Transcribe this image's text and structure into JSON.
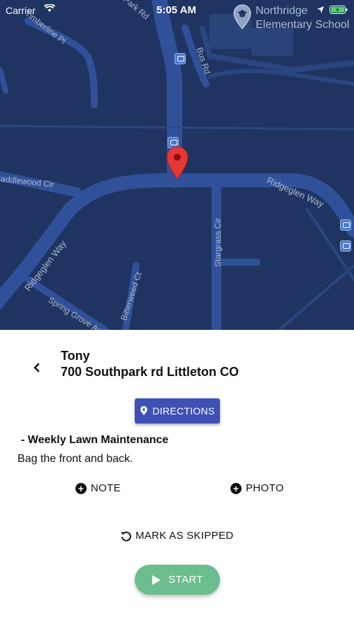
{
  "status_bar": {
    "carrier": "Carrier",
    "time": "5:05 AM"
  },
  "map": {
    "poi_label_line1": "Northridge",
    "poi_label_line2": "Elementary School",
    "streets": {
      "park_rd": "Park Rd",
      "timberline_pl": "Timberline Pl",
      "bus_rd": "Bus Rd",
      "saddlewood_cir": "Saddlewood Cir",
      "ridgeglen_way_east": "Ridgeglen Way",
      "ridgeglen_way_west": "Ridgeglen Way",
      "stargrass_cir": "Stargrass Cir",
      "bitterweed_ct": "Bitterweed Ct",
      "spring_grove": "Spring Grove Ave"
    },
    "colors": {
      "background": "#1f3461",
      "road": "#30519a",
      "marker": "#e53935"
    }
  },
  "job": {
    "client_name": "Tony",
    "address": "700 Southpark rd Littleton CO",
    "service_title": "- Weekly Lawn Maintenance",
    "service_description": "Bag the front and back."
  },
  "actions": {
    "directions_label": "DIRECTIONS",
    "note_label": "NOTE",
    "photo_label": "PHOTO",
    "skip_label": "MARK AS SKIPPED",
    "start_label": "START"
  },
  "icons": {
    "back": "chevron-left-icon",
    "directions": "location-pin-icon",
    "note": "plus-circle-icon",
    "photo": "plus-circle-icon",
    "skip": "undo-icon",
    "start": "play-icon"
  },
  "colors": {
    "directions_button": "#3f51b5",
    "start_button": "#6bbd8e"
  }
}
